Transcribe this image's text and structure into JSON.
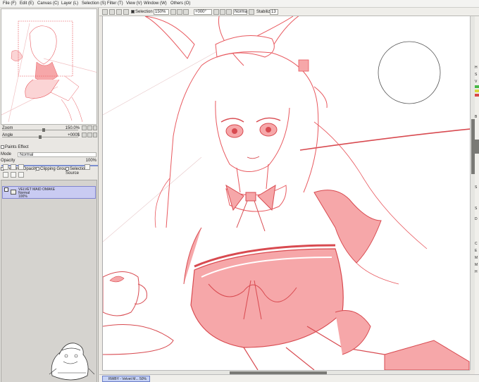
{
  "menu": [
    "File (F)",
    "Edit (E)",
    "Canvas (C)",
    "Layer (L)",
    "Selection (S)",
    "Filter (T)",
    "View (V)",
    "Window (W)",
    "Others (O)"
  ],
  "toolbar": {
    "selection_label": "Selection",
    "zoom": "150%",
    "angle": "+000°",
    "mode": "Norma",
    "stabilizer_label": "Stabilizer",
    "stabilizer_value": "13"
  },
  "navigator": {
    "zoom_label": "Zoom",
    "zoom_value": "150.0%",
    "angle_label": "Angle",
    "angle_value": "+000$",
    "zoom_fraction": 0.55,
    "angle_fraction": 0.5
  },
  "layer_panel": {
    "paints_effect": "Paints Effect",
    "mode_label": "Mode",
    "mode_value": "Normal",
    "opacity_label": "Opacity",
    "opacity_value": "100%",
    "preserve_opacity": "Preserve Opacity",
    "clipping_group": "Clipping Group",
    "selection_source": "Selection Source"
  },
  "layer": {
    "name": "VELVET MAID OMAKE",
    "mode": "Normal",
    "opacity": "100%"
  },
  "taskbar": {
    "tab_label": "RWBY - Velvet M...",
    "zoom": "50%"
  },
  "right_strip_letters": [
    "H",
    "S",
    "V",
    "B",
    "S",
    "S",
    "D",
    "C",
    "E",
    "M",
    "M",
    "H"
  ],
  "colors": {
    "sketch": "#e8585e",
    "sketch_fill": "#f6a7a9",
    "layer_highlight": "#c9cbf2",
    "menu_bg": "#f3f3f1"
  }
}
